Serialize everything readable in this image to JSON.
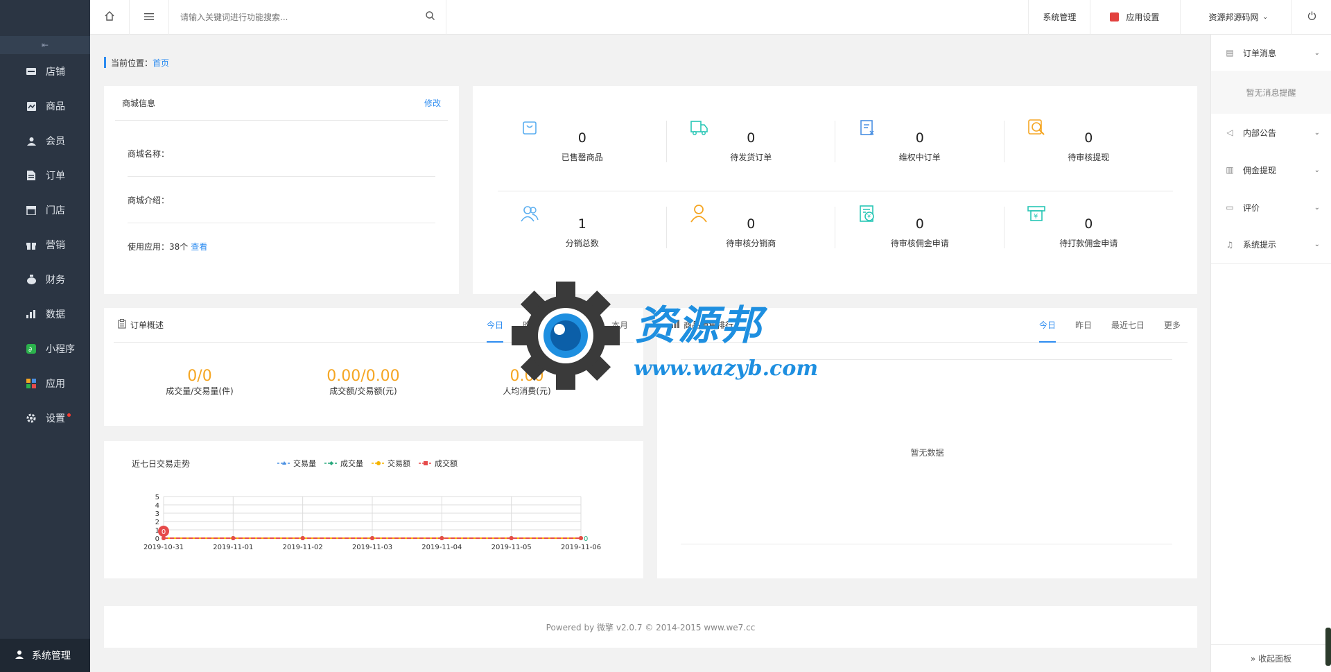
{
  "sidebar": {
    "items": [
      {
        "label": "店铺",
        "icon": "store-icon"
      },
      {
        "label": "商品",
        "icon": "goods-icon"
      },
      {
        "label": "会员",
        "icon": "member-icon"
      },
      {
        "label": "订单",
        "icon": "order-icon"
      },
      {
        "label": "门店",
        "icon": "shop-icon"
      },
      {
        "label": "营销",
        "icon": "gift-icon"
      },
      {
        "label": "财务",
        "icon": "money-bag-icon"
      },
      {
        "label": "数据",
        "icon": "bar-chart-icon"
      },
      {
        "label": "小程序",
        "icon": "mini-program-icon"
      },
      {
        "label": "应用",
        "icon": "apps-icon"
      },
      {
        "label": "设置",
        "icon": "gear-icon"
      }
    ],
    "bottom_label": "系统管理"
  },
  "topbar": {
    "search_placeholder": "请输入关键词进行功能搜索...",
    "system_mgmt": "系统管理",
    "app_settings": "应用设置",
    "account": "资源邦源码网"
  },
  "breadcrumb": {
    "prefix": "当前位置：",
    "current": "首页"
  },
  "shop_info": {
    "title": "商城信息",
    "edit": "修改",
    "name_label": "商城名称：",
    "intro_label": "商城介绍：",
    "apps_label": "使用应用：38个",
    "view_link": "查看"
  },
  "stats": [
    {
      "value": "0",
      "label": "已售罄商品",
      "icon": "bag-icon",
      "color": "#5aaef0"
    },
    {
      "value": "0",
      "label": "待发货订单",
      "icon": "truck-icon",
      "color": "#27c6b5"
    },
    {
      "value": "0",
      "label": "维权中订单",
      "icon": "rights-doc-icon",
      "color": "#4a90e2"
    },
    {
      "value": "0",
      "label": "待审核提现",
      "icon": "magnifier-icon",
      "color": "#f5a623"
    },
    {
      "value": "1",
      "label": "分销总数",
      "icon": "people-icon",
      "color": "#5aaef0"
    },
    {
      "value": "0",
      "label": "待审核分销商",
      "icon": "user-icon",
      "color": "#f5a623"
    },
    {
      "value": "0",
      "label": "待审核佣金申请",
      "icon": "commission-icon",
      "color": "#27c6b5"
    },
    {
      "value": "0",
      "label": "待打款佣金申请",
      "icon": "yen-box-icon",
      "color": "#27c6b5"
    }
  ],
  "order_overview": {
    "title": "订单概述",
    "tabs": [
      "今日",
      "昨日",
      "最近七日",
      "本月"
    ],
    "items": [
      {
        "value": "0/0",
        "label": "成交量/交易量(件)"
      },
      {
        "value": "0.00/0.00",
        "label": "成交额/交易额(元)"
      },
      {
        "value": "0.00",
        "label": "人均消费(元)"
      }
    ]
  },
  "trend": {
    "title": "近七日交易走势",
    "legend": [
      "交易量",
      "成交量",
      "交易额",
      "成交额"
    ],
    "colors": [
      "#4a90e2",
      "#27a87c",
      "#f5b400",
      "#e64b4b"
    ]
  },
  "chart_data": {
    "type": "line",
    "title": "近七日交易走势",
    "x": [
      "2019-10-31",
      "2019-11-01",
      "2019-11-02",
      "2019-11-03",
      "2019-11-04",
      "2019-11-05",
      "2019-11-06"
    ],
    "ylim": [
      0,
      5
    ],
    "yticks": [
      0,
      1,
      2,
      3,
      4,
      5
    ],
    "series": [
      {
        "name": "交易量",
        "values": [
          0,
          0,
          0,
          0,
          0,
          0,
          0
        ]
      },
      {
        "name": "成交量",
        "values": [
          0,
          0,
          0,
          0,
          0,
          0,
          0
        ]
      },
      {
        "name": "交易额",
        "values": [
          0,
          0,
          0,
          0,
          0,
          0,
          0
        ]
      },
      {
        "name": "成交额",
        "values": [
          0,
          0,
          0,
          0,
          0,
          0,
          0
        ]
      }
    ],
    "point_labels": {
      "first": "0",
      "last": "0"
    },
    "legend_position": "top"
  },
  "goods": {
    "title": "商品销售排行",
    "tabs": [
      "今日",
      "昨日",
      "最近七日",
      "更多"
    ],
    "empty": "暂无数据"
  },
  "footer": "Powered by 微擎 v2.0.7 © 2014-2015 www.we7.cc",
  "right_panel": {
    "items": [
      {
        "label": "订单消息",
        "icon": "clipboard-icon"
      },
      {
        "label": "内部公告",
        "icon": "speaker-icon"
      },
      {
        "label": "佣金提现",
        "icon": "commission-doc-icon"
      },
      {
        "label": "评价",
        "icon": "comment-icon"
      },
      {
        "label": "系统提示",
        "icon": "bell-icon"
      }
    ],
    "empty_msg": "暂无消息提醒",
    "collapse": "» 收起面板"
  },
  "watermark": {
    "text": "资源邦",
    "url": "www.wazyb.com"
  }
}
